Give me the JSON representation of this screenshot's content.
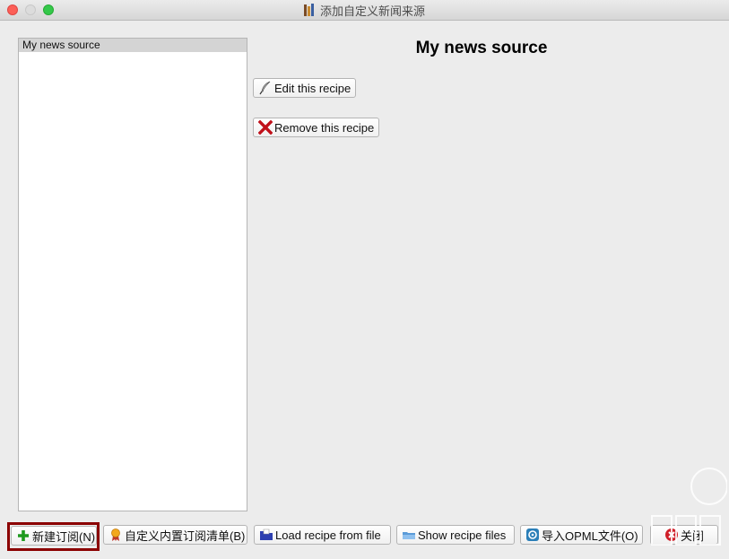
{
  "window": {
    "title": "添加自定义新闻来源"
  },
  "sources": {
    "items": [
      {
        "label": "My news source"
      }
    ]
  },
  "detail": {
    "heading": "My news source",
    "edit_label": "Edit this recipe",
    "remove_label": "Remove this recipe"
  },
  "footer": {
    "new_label": "新建订阅(N)",
    "customize_builtin_label": "自定义内置订阅清单(B)",
    "load_file_label": "Load recipe from file",
    "show_files_label": "Show recipe files",
    "import_opml_label": "导入OPML文件(O)",
    "close_label": "关闭"
  },
  "colors": {
    "highlight_border": "#8b0000",
    "list_selected_bg": "#d4d4d4",
    "window_bg": "#ececec"
  },
  "icons": {
    "edit": "quill-pen-icon",
    "remove": "red-x-icon",
    "new": "green-plus-icon",
    "customize": "award-ribbon-icon",
    "load": "folder-icon",
    "show": "folder-open-icon",
    "import": "opml-icon",
    "close": "close-circle-icon"
  }
}
